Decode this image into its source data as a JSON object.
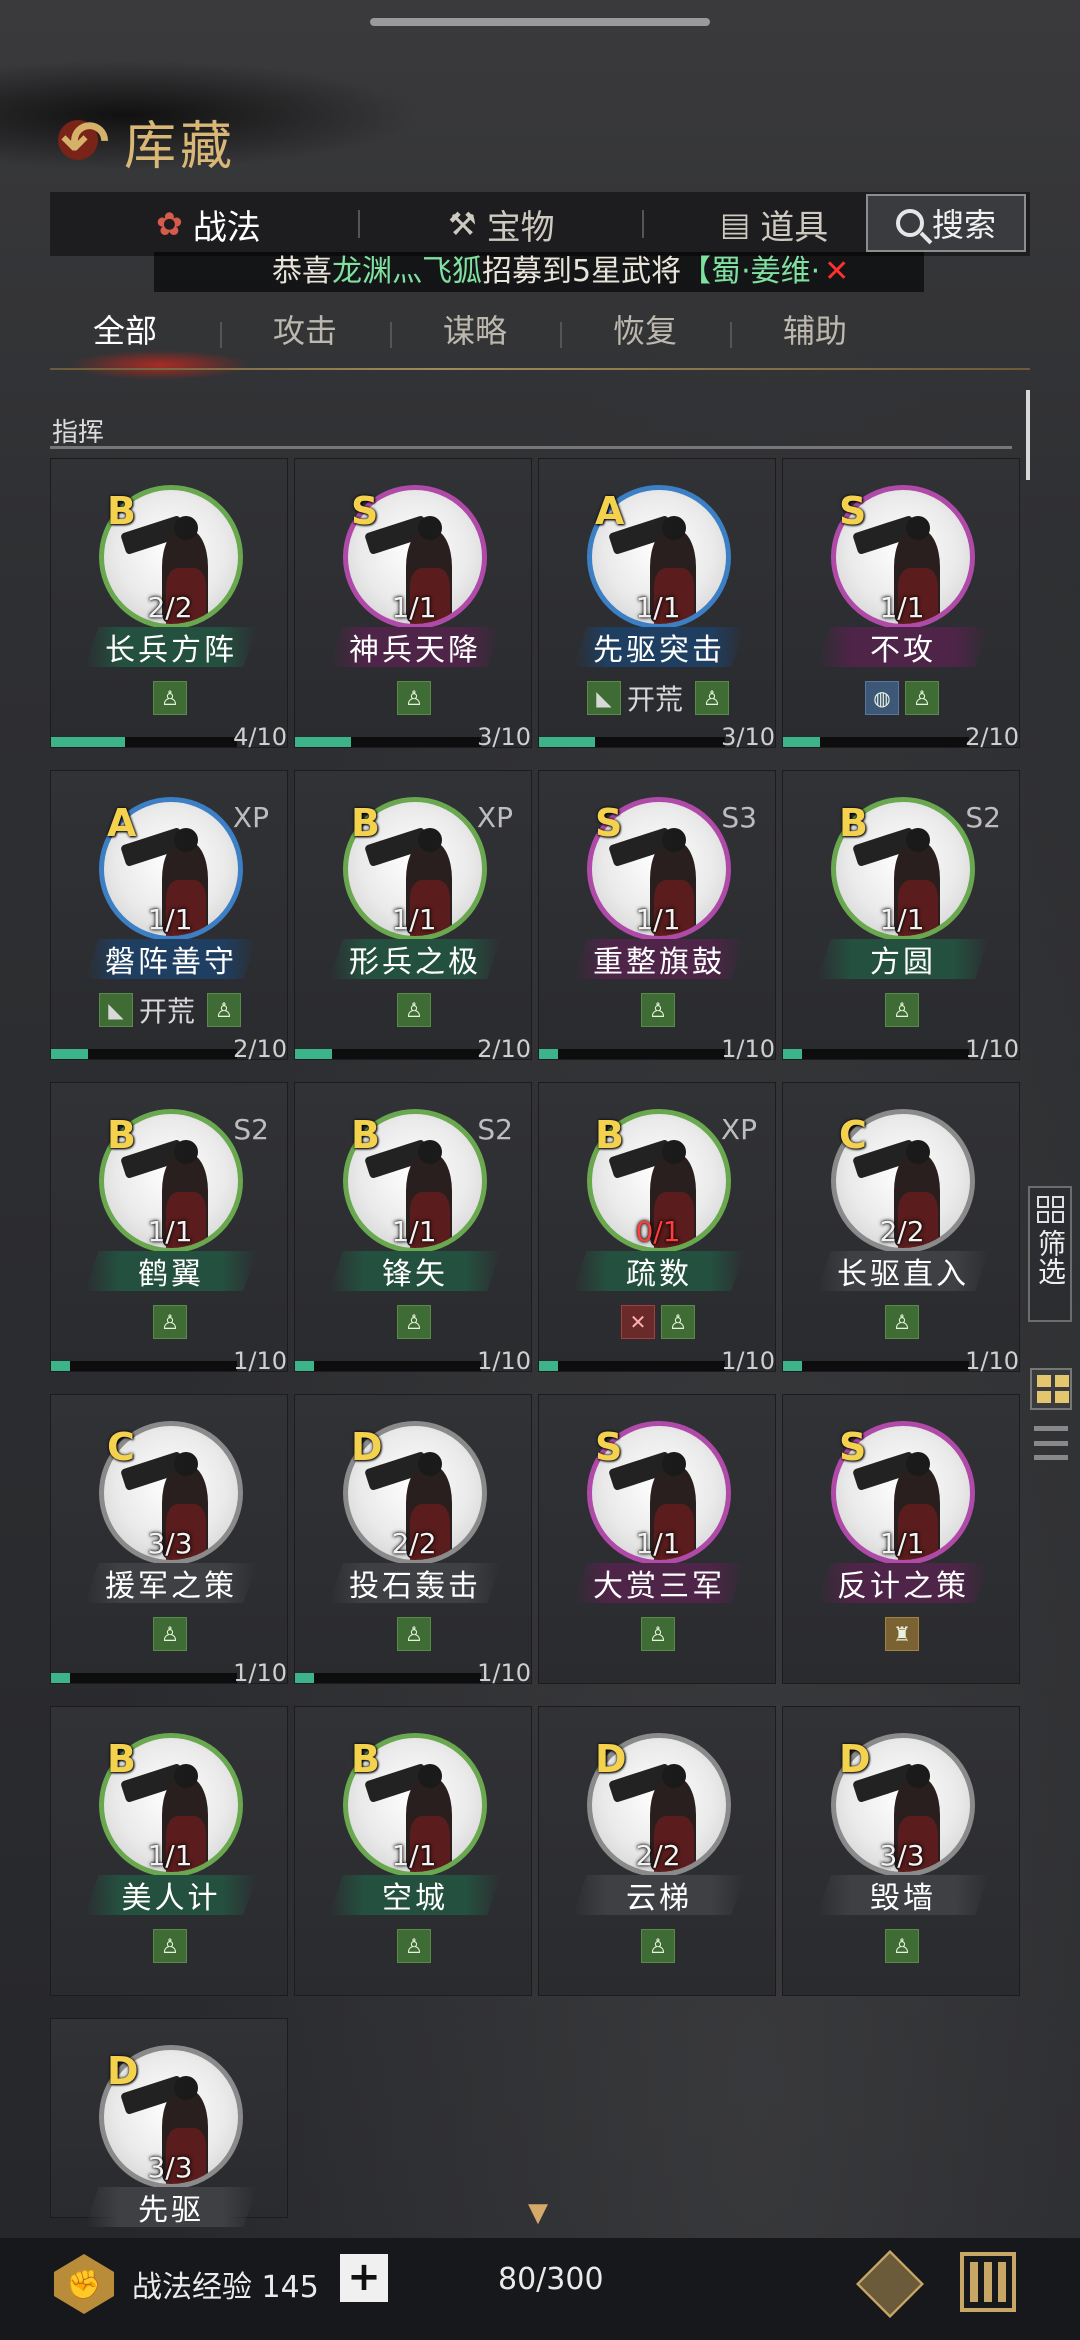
{
  "header": {
    "title": "库藏"
  },
  "main_tabs": [
    {
      "label": "战法",
      "icon": "scroll-icon",
      "active": true
    },
    {
      "label": "宝物",
      "icon": "anvil-icon",
      "active": false
    },
    {
      "label": "道具",
      "icon": "chest-icon",
      "active": false
    }
  ],
  "search": {
    "label": "搜索"
  },
  "marquee": {
    "prefix": "恭喜",
    "player": "龙渊灬飞狐",
    "middle": "招募到5星武将",
    "hero": "【蜀·姜维·",
    "close": "✕"
  },
  "sub_tabs": [
    "全部",
    "攻击",
    "谋略",
    "恢复",
    "辅助"
  ],
  "section": {
    "title": "指挥"
  },
  "tag_text": {
    "kaihuang": "开荒"
  },
  "cards": [
    {
      "grade": "B",
      "tier": "",
      "count": "2/2",
      "name": "长兵方阵",
      "ring": "green",
      "bar": "teal",
      "tags": [
        "green"
      ],
      "progress": "4/10",
      "p": 0.4
    },
    {
      "grade": "S",
      "tier": "",
      "count": "1/1",
      "name": "神兵天降",
      "ring": "purple",
      "bar": "purple",
      "tags": [
        "green"
      ],
      "progress": "3/10",
      "p": 0.3
    },
    {
      "grade": "A",
      "tier": "",
      "count": "1/1",
      "name": "先驱突击",
      "ring": "blue",
      "bar": "blue",
      "tags": [
        "kaihuang",
        "green"
      ],
      "progress": "3/10",
      "p": 0.3
    },
    {
      "grade": "S",
      "tier": "",
      "count": "1/1",
      "name": "不攻",
      "ring": "purple",
      "bar": "purple",
      "tags": [
        "blue",
        "green"
      ],
      "progress": "2/10",
      "p": 0.2
    },
    {
      "grade": "A",
      "tier": "XP",
      "count": "1/1",
      "name": "磐阵善守",
      "ring": "blue",
      "bar": "blue",
      "tags": [
        "kaihuang",
        "green"
      ],
      "progress": "2/10",
      "p": 0.2
    },
    {
      "grade": "B",
      "tier": "XP",
      "count": "1/1",
      "name": "形兵之极",
      "ring": "green",
      "bar": "teal",
      "tags": [
        "green"
      ],
      "progress": "2/10",
      "p": 0.2
    },
    {
      "grade": "S",
      "tier": "S3",
      "count": "1/1",
      "name": "重整旗鼓",
      "ring": "purple",
      "bar": "purple",
      "tags": [
        "green"
      ],
      "progress": "1/10",
      "p": 0.1
    },
    {
      "grade": "B",
      "tier": "S2",
      "count": "1/1",
      "name": "方圆",
      "ring": "green",
      "bar": "teal",
      "tags": [
        "green"
      ],
      "progress": "1/10",
      "p": 0.1
    },
    {
      "grade": "B",
      "tier": "S2",
      "count": "1/1",
      "name": "鹤翼",
      "ring": "green",
      "bar": "teal",
      "tags": [
        "green"
      ],
      "progress": "1/10",
      "p": 0.1
    },
    {
      "grade": "B",
      "tier": "S2",
      "count": "1/1",
      "name": "锋矢",
      "ring": "green",
      "bar": "teal",
      "tags": [
        "green"
      ],
      "progress": "1/10",
      "p": 0.1
    },
    {
      "grade": "B",
      "tier": "XP",
      "count": "0/1",
      "name": "疏数",
      "ring": "green",
      "bar": "teal",
      "tags": [
        "red",
        "green"
      ],
      "progress": "1/10",
      "p": 0.1
    },
    {
      "grade": "C",
      "tier": "",
      "count": "2/2",
      "name": "长驱直入",
      "ring": "gray",
      "bar": "gray",
      "tags": [
        "green"
      ],
      "progress": "1/10",
      "p": 0.1
    },
    {
      "grade": "C",
      "tier": "",
      "count": "3/3",
      "name": "援军之策",
      "ring": "gray",
      "bar": "gray",
      "tags": [
        "green"
      ],
      "progress": "1/10",
      "p": 0.1
    },
    {
      "grade": "D",
      "tier": "",
      "count": "2/2",
      "name": "投石轰击",
      "ring": "gray",
      "bar": "gray",
      "tags": [
        "green"
      ],
      "progress": "1/10",
      "p": 0.1
    },
    {
      "grade": "S",
      "tier": "",
      "count": "1/1",
      "name": "大赏三军",
      "ring": "purple",
      "bar": "purple",
      "tags": [
        "green"
      ],
      "progress": "",
      "p": 0
    },
    {
      "grade": "S",
      "tier": "",
      "count": "1/1",
      "name": "反计之策",
      "ring": "purple",
      "bar": "purple",
      "tags": [
        "gold"
      ],
      "progress": "",
      "p": 0
    },
    {
      "grade": "B",
      "tier": "",
      "count": "1/1",
      "name": "美人计",
      "ring": "green",
      "bar": "teal",
      "tags": [
        "green"
      ],
      "progress": "",
      "p": 0
    },
    {
      "grade": "B",
      "tier": "",
      "count": "1/1",
      "name": "空城",
      "ring": "green",
      "bar": "teal",
      "tags": [
        "green"
      ],
      "progress": "",
      "p": 0
    },
    {
      "grade": "D",
      "tier": "",
      "count": "2/2",
      "name": "云梯",
      "ring": "gray",
      "bar": "gray",
      "tags": [
        "green"
      ],
      "progress": "",
      "p": 0
    },
    {
      "grade": "D",
      "tier": "",
      "count": "3/3",
      "name": "毁墙",
      "ring": "gray",
      "bar": "gray",
      "tags": [
        "green"
      ],
      "progress": "",
      "p": 0
    },
    {
      "grade": "D",
      "tier": "",
      "count": "3/3",
      "name": "先驱",
      "ring": "gray",
      "bar": "gray",
      "tags": [],
      "progress": "",
      "p": 0
    }
  ],
  "side": {
    "filter": "筛选"
  },
  "bottom": {
    "exp_label": "战法经验 145",
    "plus": "+",
    "capacity": "80/300"
  },
  "colors": {
    "ring_green": "#6aa84f",
    "ring_purple": "#b04aa8",
    "ring_blue": "#3d7fc4",
    "ring_gray": "#8a8a8a",
    "bar_teal": "#24503f",
    "bar_purple": "#4e2448",
    "bar_blue": "#1f3f62",
    "bar_gray": "#3f4043",
    "accent_gold": "#d8b777"
  }
}
